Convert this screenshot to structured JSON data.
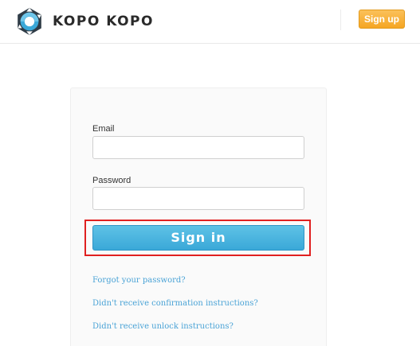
{
  "header": {
    "brand": "KOPO KOPO",
    "signup_label": "Sign up"
  },
  "form": {
    "email_label": "Email",
    "email_value": "",
    "password_label": "Password",
    "password_value": "",
    "signin_label": "Sign in"
  },
  "links": {
    "forgot_password": "Forgot your password?",
    "confirmation": "Didn't receive confirmation instructions?",
    "unlock": "Didn't receive unlock instructions?"
  },
  "colors": {
    "signup": "#f5a623",
    "signin": "#3aa8d8",
    "link": "#4aa3d6",
    "highlight": "#e02020"
  }
}
